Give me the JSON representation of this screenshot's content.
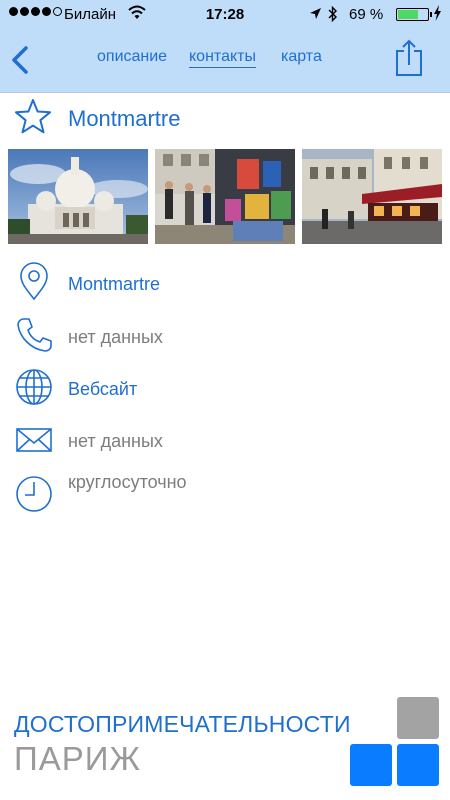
{
  "status_bar": {
    "carrier": "Билайн",
    "time": "17:28",
    "battery_text": "69 %",
    "battery_level": 0.69
  },
  "nav": {
    "tabs": [
      {
        "label": "описание",
        "active": false
      },
      {
        "label": "контакты",
        "active": true
      },
      {
        "label": "карта",
        "active": false
      }
    ]
  },
  "place": {
    "title": "Montmartre",
    "photos": [
      "sacre-coeur-photo",
      "artists-square-photo",
      "cafe-street-photo"
    ]
  },
  "contacts": {
    "address": "Montmartre",
    "phone": "нет данных",
    "website": "Вебсайт",
    "email": "нет данных",
    "hours": "круглосуточно"
  },
  "footer": {
    "line1": "ДОСТОПРИМЕЧАТЕЛЬНОСТИ",
    "line2": "ПАРИЖ"
  },
  "colors": {
    "accent": "#1f6fd1",
    "topbar": "#bfdcf9",
    "tile_blue": "#0a7cff",
    "tile_gray": "#a3a3a3"
  }
}
